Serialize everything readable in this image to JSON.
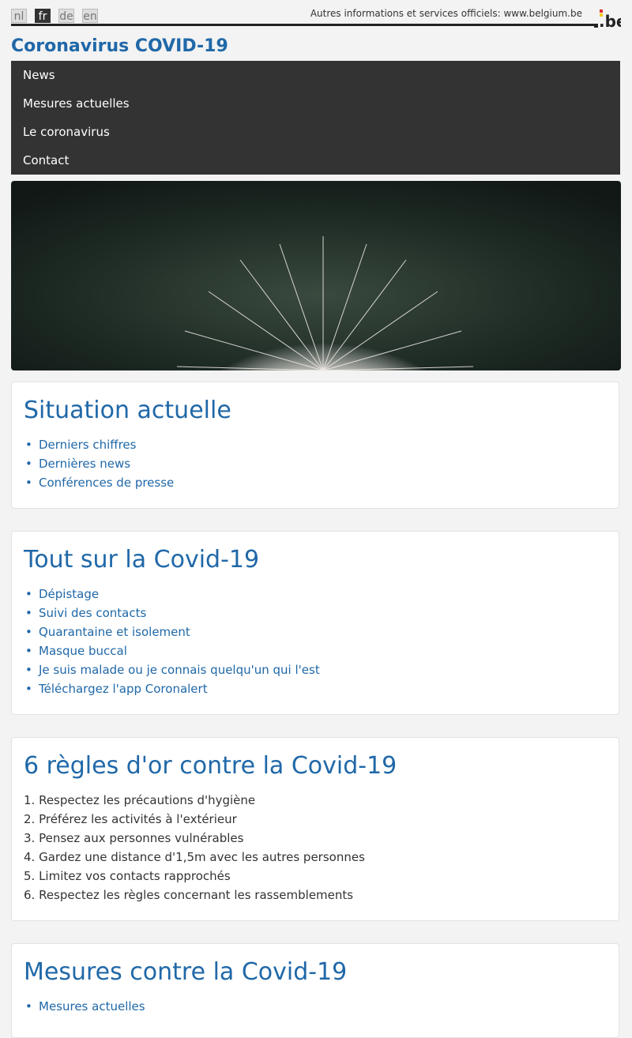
{
  "languages": [
    {
      "code": "nl",
      "active": false
    },
    {
      "code": "fr",
      "active": true
    },
    {
      "code": "de",
      "active": false
    },
    {
      "code": "en",
      "active": false
    }
  ],
  "header": {
    "official_text": "Autres informations et services officiels: www.belgium.be",
    "logo_text": ".be",
    "site_title": "Coronavirus COVID-19"
  },
  "nav": {
    "items": [
      "News",
      "Mesures actuelles",
      "Le coronavirus",
      "Contact"
    ]
  },
  "hero": {
    "icon": "dandelion-image"
  },
  "sections": [
    {
      "title": "Situation actuelle",
      "links": [
        "Derniers chiffres",
        "Dernières news",
        "Conférences de presse"
      ]
    },
    {
      "title": "Tout sur la Covid-19",
      "links": [
        "Dépistage",
        "Suivi des contacts",
        "Quarantaine et isolement",
        "Masque buccal",
        "Je suis malade ou je connais quelqu'un qui l'est",
        "Téléchargez l'app Coronalert"
      ]
    },
    {
      "title": "6 règles d'or contre la Covid-19",
      "rules": [
        "1. Respectez les précautions d'hygiène",
        "2. Préférez les activités à l'extérieur",
        "3. Pensez aux personnes vulnérables",
        "4. Gardez une distance d'1,5m avec les autres personnes",
        "5. Limitez vos contacts rapprochés",
        "6. Respectez les règles concernant les rassemblements"
      ]
    },
    {
      "title": "Mesures contre la Covid-19",
      "links": [
        "Mesures actuelles"
      ]
    }
  ],
  "colors": {
    "accent": "#2068a8",
    "nav_bg": "#333333",
    "page_bg": "#f3f3f3"
  }
}
